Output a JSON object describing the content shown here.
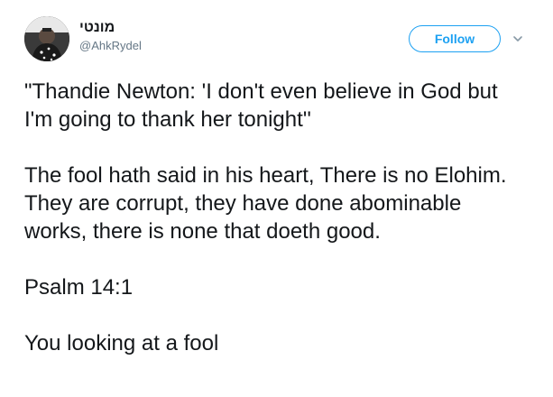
{
  "user": {
    "display_name": "מונטי",
    "handle": "@AhkRydel"
  },
  "header": {
    "follow_label": "Follow",
    "caret_icon": "chevron-down-icon"
  },
  "tweet": {
    "paragraphs": [
      "\"Thandie Newton: 'I don't even believe in God but I'm going to thank her tonight''",
      "The fool hath said in his heart, There is no Elohim. They are corrupt, they have done abominable works, there is none that doeth good.",
      "Psalm 14:1",
      "You looking at a fool"
    ]
  },
  "colors": {
    "accent": "#1da1f2",
    "text": "#14171a",
    "muted": "#657786"
  }
}
